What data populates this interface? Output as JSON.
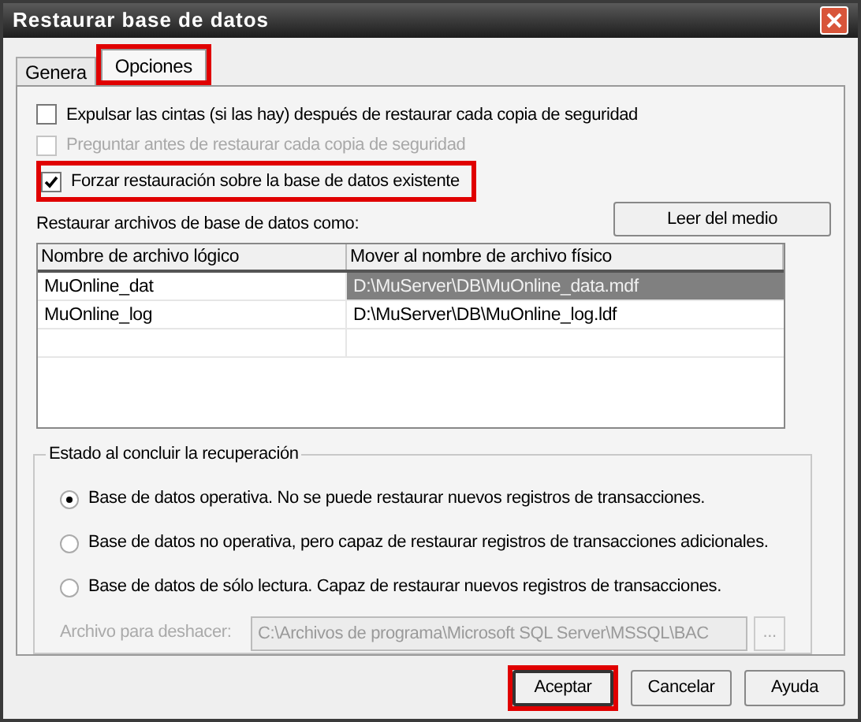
{
  "window": {
    "title": "Restaurar base de datos"
  },
  "tabs": [
    {
      "label": "Genera",
      "selected": false,
      "highlighted": false
    },
    {
      "label": "Opciones",
      "selected": true,
      "highlighted": true
    }
  ],
  "options": [
    {
      "label": "Expulsar las cintas (si las hay) después de restaurar cada copia de seguridad",
      "checked": false,
      "disabled": false,
      "highlighted": false
    },
    {
      "label": "Preguntar antes de restaurar cada copia de seguridad",
      "checked": false,
      "disabled": true,
      "highlighted": false
    },
    {
      "label": "Forzar restauración sobre la base de datos existente",
      "checked": true,
      "disabled": false,
      "highlighted": true
    }
  ],
  "files": {
    "label": "Restaurar archivos de base de datos como:",
    "read_button": "Leer del medio",
    "columns": [
      "Nombre de archivo lógico",
      "Mover al nombre de archivo físico"
    ],
    "rows": [
      {
        "logical": "MuOnline_dat",
        "physical": "D:\\MuServer\\DB\\MuOnline_data.mdf",
        "selected": true
      },
      {
        "logical": "MuOnline_log",
        "physical": "D:\\MuServer\\DB\\MuOnline_log.ldf",
        "selected": false
      }
    ]
  },
  "recovery": {
    "title": "Estado al concluir la recuperación",
    "choices": [
      {
        "label": "Base de datos operativa. No se puede restaurar nuevos registros de transacciones.",
        "selected": true
      },
      {
        "label": "Base de datos no operativa, pero capaz de restaurar registros de transacciones adicionales.",
        "selected": false
      },
      {
        "label": "Base de datos de sólo lectura. Capaz de restaurar nuevos registros de transacciones.",
        "selected": false
      }
    ],
    "undo_label": "Archivo para deshacer:",
    "undo_value": "C:\\Archivos de programa\\Microsoft SQL Server\\MSSQL\\BAC",
    "browse": "..."
  },
  "buttons": [
    {
      "label": "Aceptar",
      "highlighted": true
    },
    {
      "label": "Cancelar",
      "highlighted": false
    },
    {
      "label": "Ayuda",
      "highlighted": false
    }
  ]
}
